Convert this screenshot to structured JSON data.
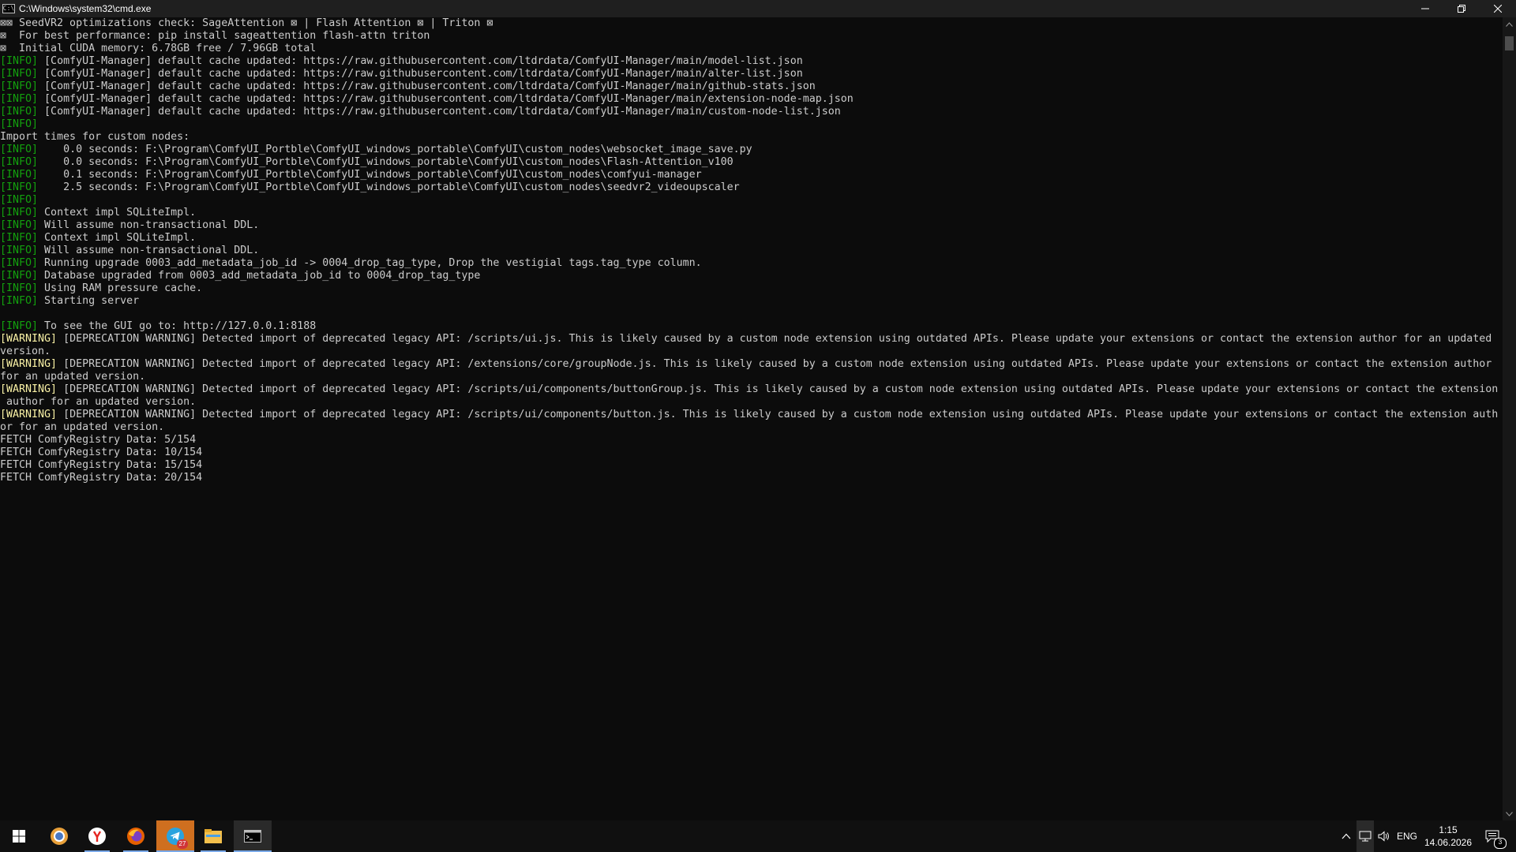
{
  "window": {
    "title": "C:\\Windows\\system32\\cmd.exe",
    "icon": "cmd-icon",
    "controls": [
      "minimize-icon",
      "restore-icon",
      "close-icon"
    ]
  },
  "console": {
    "lines": [
      {
        "tag": "",
        "text": "⊠⊠ SeedVR2 optimizations check: SageAttention ⊠ | Flash Attention ⊠ | Triton ⊠"
      },
      {
        "tag": "",
        "text": "⊠  For best performance: pip install sageattention flash-attn triton"
      },
      {
        "tag": "",
        "text": "⊠  Initial CUDA memory: 6.78GB free / 7.96GB total"
      },
      {
        "tag": "[INFO]",
        "text": " [ComfyUI-Manager] default cache updated: https://raw.githubusercontent.com/ltdrdata/ComfyUI-Manager/main/model-list.json"
      },
      {
        "tag": "[INFO]",
        "text": " [ComfyUI-Manager] default cache updated: https://raw.githubusercontent.com/ltdrdata/ComfyUI-Manager/main/alter-list.json"
      },
      {
        "tag": "[INFO]",
        "text": " [ComfyUI-Manager] default cache updated: https://raw.githubusercontent.com/ltdrdata/ComfyUI-Manager/main/github-stats.json"
      },
      {
        "tag": "[INFO]",
        "text": " [ComfyUI-Manager] default cache updated: https://raw.githubusercontent.com/ltdrdata/ComfyUI-Manager/main/extension-node-map.json"
      },
      {
        "tag": "[INFO]",
        "text": " [ComfyUI-Manager] default cache updated: https://raw.githubusercontent.com/ltdrdata/ComfyUI-Manager/main/custom-node-list.json"
      },
      {
        "tag": "[INFO]",
        "text": ""
      },
      {
        "tag": "",
        "text": "Import times for custom nodes:"
      },
      {
        "tag": "[INFO]",
        "text": "    0.0 seconds: F:\\Program\\ComfyUI_Portble\\ComfyUI_windows_portable\\ComfyUI\\custom_nodes\\websocket_image_save.py"
      },
      {
        "tag": "[INFO]",
        "text": "    0.0 seconds: F:\\Program\\ComfyUI_Portble\\ComfyUI_windows_portable\\ComfyUI\\custom_nodes\\Flash-Attention_v100"
      },
      {
        "tag": "[INFO]",
        "text": "    0.1 seconds: F:\\Program\\ComfyUI_Portble\\ComfyUI_windows_portable\\ComfyUI\\custom_nodes\\comfyui-manager"
      },
      {
        "tag": "[INFO]",
        "text": "    2.5 seconds: F:\\Program\\ComfyUI_Portble\\ComfyUI_windows_portable\\ComfyUI\\custom_nodes\\seedvr2_videoupscaler"
      },
      {
        "tag": "[INFO]",
        "text": ""
      },
      {
        "tag": "[INFO]",
        "text": " Context impl SQLiteImpl."
      },
      {
        "tag": "[INFO]",
        "text": " Will assume non-transactional DDL."
      },
      {
        "tag": "[INFO]",
        "text": " Context impl SQLiteImpl."
      },
      {
        "tag": "[INFO]",
        "text": " Will assume non-transactional DDL."
      },
      {
        "tag": "[INFO]",
        "text": " Running upgrade 0003_add_metadata_job_id -> 0004_drop_tag_type, Drop the vestigial tags.tag_type column."
      },
      {
        "tag": "[INFO]",
        "text": " Database upgraded from 0003_add_metadata_job_id to 0004_drop_tag_type"
      },
      {
        "tag": "[INFO]",
        "text": " Using RAM pressure cache."
      },
      {
        "tag": "[INFO]",
        "text": " Starting server"
      },
      {
        "tag": "",
        "text": ""
      },
      {
        "tag": "[INFO]",
        "text": " To see the GUI go to: http://127.0.0.1:8188"
      },
      {
        "tag": "[WARNING]",
        "text": " [DEPRECATION WARNING] Detected import of deprecated legacy API: /scripts/ui.js. This is likely caused by a custom node extension using outdated APIs. Please update your extensions or contact the extension author for an updated"
      },
      {
        "tag": "",
        "text": "version."
      },
      {
        "tag": "[WARNING]",
        "text": " [DEPRECATION WARNING] Detected import of deprecated legacy API: /extensions/core/groupNode.js. This is likely caused by a custom node extension using outdated APIs. Please update your extensions or contact the extension author"
      },
      {
        "tag": "",
        "text": "for an updated version."
      },
      {
        "tag": "[WARNING]",
        "text": " [DEPRECATION WARNING] Detected import of deprecated legacy API: /scripts/ui/components/buttonGroup.js. This is likely caused by a custom node extension using outdated APIs. Please update your extensions or contact the extension"
      },
      {
        "tag": "",
        "text": " author for an updated version."
      },
      {
        "tag": "[WARNING]",
        "text": " [DEPRECATION WARNING] Detected import of deprecated legacy API: /scripts/ui/components/button.js. This is likely caused by a custom node extension using outdated APIs. Please update your extensions or contact the extension auth"
      },
      {
        "tag": "",
        "text": "or for an updated version."
      },
      {
        "tag": "",
        "text": "FETCH ComfyRegistry Data: 5/154"
      },
      {
        "tag": "",
        "text": "FETCH ComfyRegistry Data: 10/154"
      },
      {
        "tag": "",
        "text": "FETCH ComfyRegistry Data: 15/154"
      },
      {
        "tag": "",
        "text": "FETCH ComfyRegistry Data: 20/154"
      }
    ]
  },
  "taskbar": {
    "apps": [
      {
        "name": "start-button",
        "icon": "windows-logo-icon"
      },
      {
        "name": "taskbar-app-chromium",
        "icon": "chromium-icon"
      },
      {
        "name": "taskbar-app-yandex",
        "icon": "yandex-browser-icon"
      },
      {
        "name": "taskbar-app-firefox",
        "icon": "firefox-icon"
      },
      {
        "name": "taskbar-app-telegram",
        "icon": "telegram-icon",
        "badge": "27"
      },
      {
        "name": "taskbar-app-explorer",
        "icon": "file-explorer-icon"
      },
      {
        "name": "taskbar-app-cmd",
        "icon": "terminal-icon"
      }
    ],
    "tray": {
      "language": "ENG",
      "time": "1:15",
      "date": "14.06.2026",
      "notifications_count": "3"
    }
  },
  "colors": {
    "console_bg": "#0c0c0c",
    "console_text": "#cccccc",
    "info_tag": "#13a10e",
    "warning_tag": "#f9f1a5",
    "taskbar_bg": "#101010",
    "accent": "#7aa9e8"
  }
}
